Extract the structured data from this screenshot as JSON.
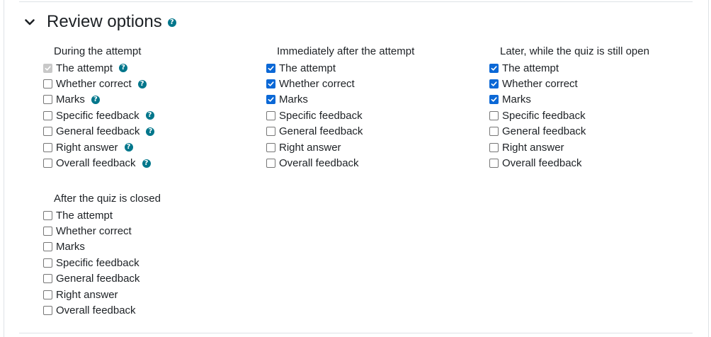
{
  "section": {
    "title": "Review options"
  },
  "groups": [
    {
      "title": "During the attempt",
      "options": [
        {
          "label": "The attempt",
          "state": "disabled",
          "help": true
        },
        {
          "label": "Whether correct",
          "state": "unchecked",
          "help": true
        },
        {
          "label": "Marks",
          "state": "unchecked",
          "help": true
        },
        {
          "label": "Specific feedback",
          "state": "unchecked",
          "help": true
        },
        {
          "label": "General feedback",
          "state": "unchecked",
          "help": true
        },
        {
          "label": "Right answer",
          "state": "unchecked",
          "help": true
        },
        {
          "label": "Overall feedback",
          "state": "unchecked",
          "help": true
        }
      ]
    },
    {
      "title": "Immediately after the attempt",
      "options": [
        {
          "label": "The attempt",
          "state": "checked",
          "help": false
        },
        {
          "label": "Whether correct",
          "state": "checked",
          "help": false
        },
        {
          "label": "Marks",
          "state": "checked",
          "help": false
        },
        {
          "label": "Specific feedback",
          "state": "unchecked",
          "help": false
        },
        {
          "label": "General feedback",
          "state": "unchecked",
          "help": false
        },
        {
          "label": "Right answer",
          "state": "unchecked",
          "help": false
        },
        {
          "label": "Overall feedback",
          "state": "unchecked",
          "help": false
        }
      ]
    },
    {
      "title": "Later, while the quiz is still open",
      "options": [
        {
          "label": "The attempt",
          "state": "checked",
          "help": false
        },
        {
          "label": "Whether correct",
          "state": "checked",
          "help": false
        },
        {
          "label": "Marks",
          "state": "checked",
          "help": false
        },
        {
          "label": "Specific feedback",
          "state": "unchecked",
          "help": false
        },
        {
          "label": "General feedback",
          "state": "unchecked",
          "help": false
        },
        {
          "label": "Right answer",
          "state": "unchecked",
          "help": false
        },
        {
          "label": "Overall feedback",
          "state": "unchecked",
          "help": false
        }
      ]
    },
    {
      "title": "After the quiz is closed",
      "options": [
        {
          "label": "The attempt",
          "state": "unchecked",
          "help": false
        },
        {
          "label": "Whether correct",
          "state": "unchecked",
          "help": false
        },
        {
          "label": "Marks",
          "state": "unchecked",
          "help": false
        },
        {
          "label": "Specific feedback",
          "state": "unchecked",
          "help": false
        },
        {
          "label": "General feedback",
          "state": "unchecked",
          "help": false
        },
        {
          "label": "Right answer",
          "state": "unchecked",
          "help": false
        },
        {
          "label": "Overall feedback",
          "state": "unchecked",
          "help": false
        }
      ]
    }
  ],
  "help_icon": {
    "glyph": "?"
  },
  "colors": {
    "accent": "#0b68d6",
    "help": "#00768b",
    "disabled": "#c8c8c8"
  }
}
